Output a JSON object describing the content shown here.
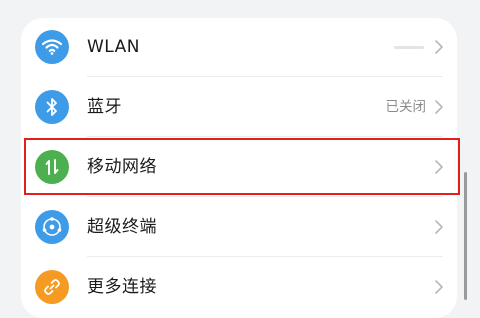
{
  "settings_list": {
    "items": [
      {
        "label": "WLAN",
        "status": "",
        "icon": "wifi-icon",
        "icon_color": "#3e9be8"
      },
      {
        "label": "蓝牙",
        "status": "已关闭",
        "icon": "bluetooth-icon",
        "icon_color": "#3e9be8"
      },
      {
        "label": "移动网络",
        "status": "",
        "icon": "mobile-data-icon",
        "icon_color": "#4caf50"
      },
      {
        "label": "超级终端",
        "status": "",
        "icon": "super-device-icon",
        "icon_color": "#3e9be8"
      },
      {
        "label": "更多连接",
        "status": "",
        "icon": "link-icon",
        "icon_color": "#f59a23"
      }
    ]
  },
  "highlight_color": "#e0201c"
}
